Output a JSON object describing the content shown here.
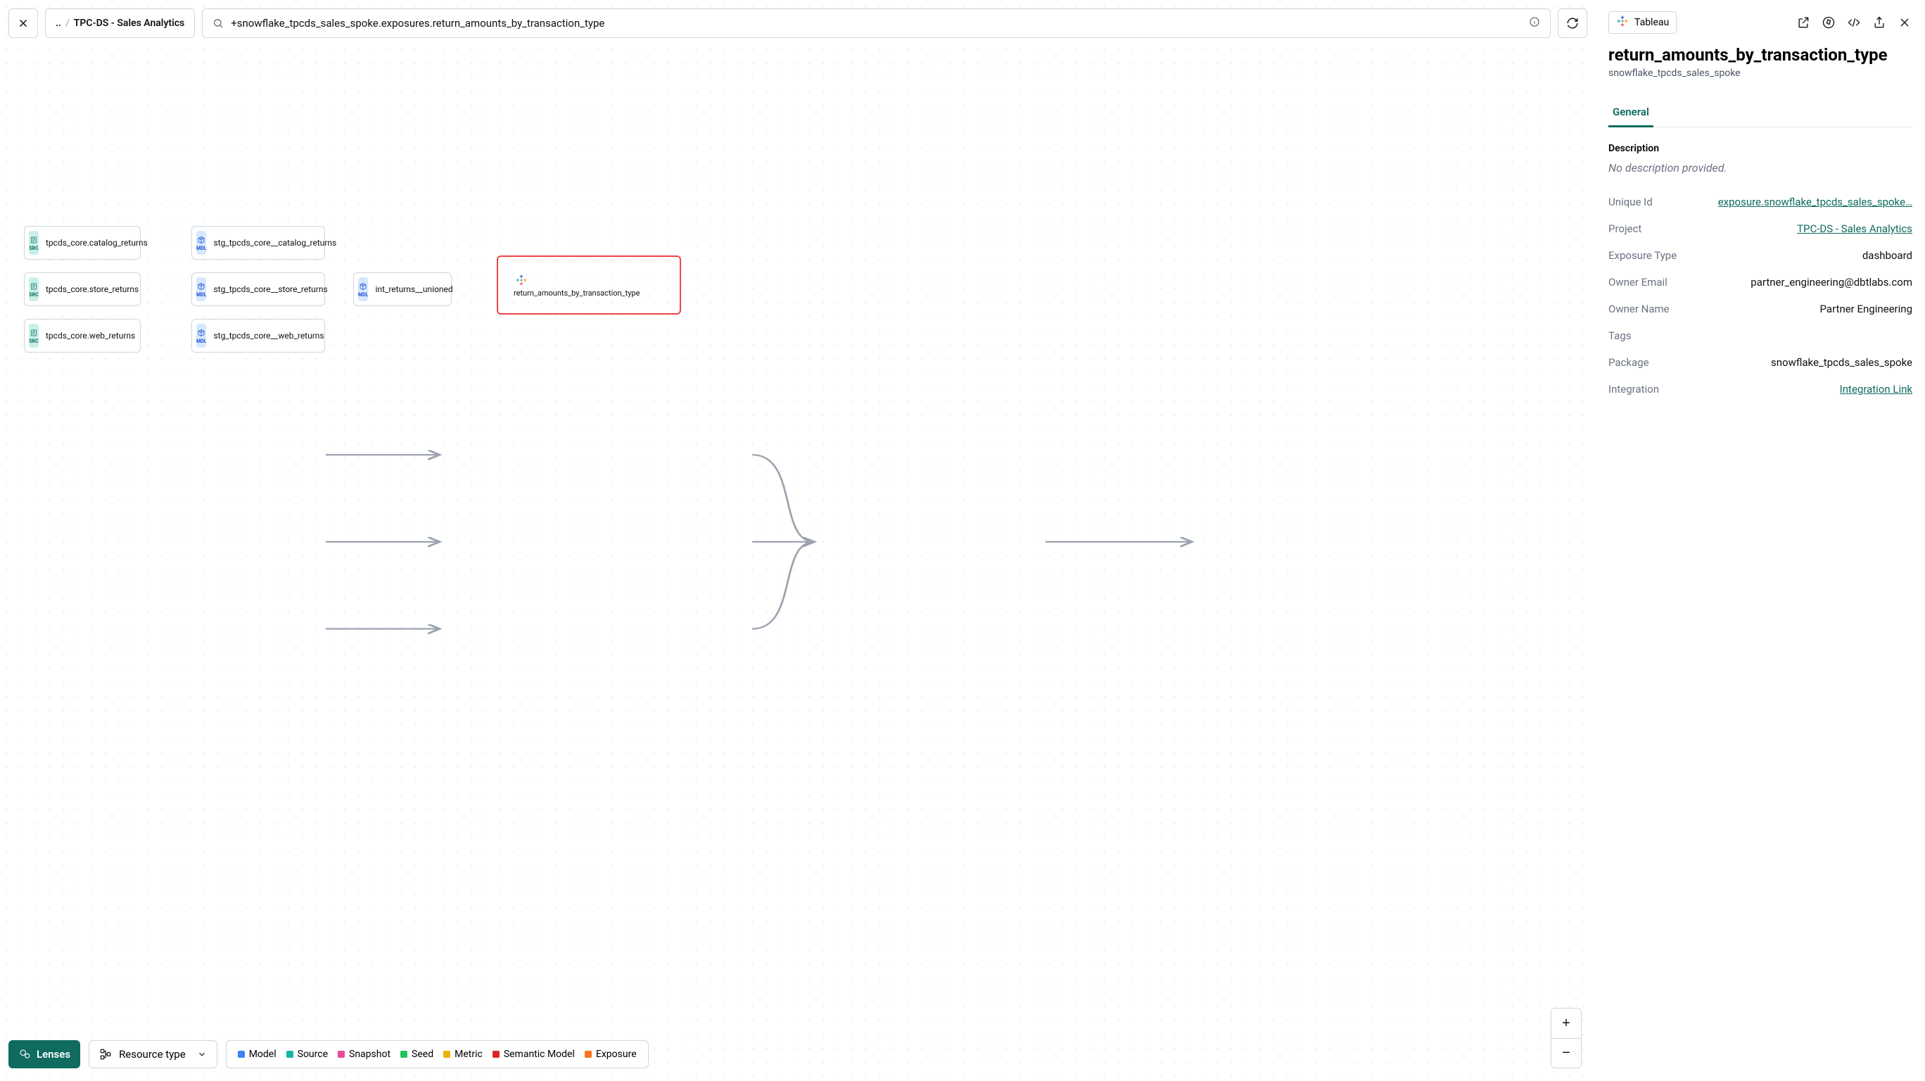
{
  "breadcrumb": {
    "prefix": "..",
    "project": "TPC-DS - Sales Analytics"
  },
  "search": {
    "query": "+snowflake_tpcds_sales_spoke.exposures.return_amounts_by_transaction_type"
  },
  "lenses_label": "Lenses",
  "resource_type_label": "Resource type",
  "legend": [
    {
      "label": "Model",
      "color": "#3b82f6"
    },
    {
      "label": "Source",
      "color": "#14b8a6"
    },
    {
      "label": "Snapshot",
      "color": "#ec4899"
    },
    {
      "label": "Seed",
      "color": "#22c55e"
    },
    {
      "label": "Metric",
      "color": "#eab308"
    },
    {
      "label": "Semantic Model",
      "color": "#dc2626"
    },
    {
      "label": "Exposure",
      "color": "#f97316"
    }
  ],
  "nodes": {
    "src_catalog": {
      "type": "SRC",
      "label": "tpcds_core.catalog_returns"
    },
    "src_store": {
      "type": "SRC",
      "label": "tpcds_core.store_returns"
    },
    "src_web": {
      "type": "SRC",
      "label": "tpcds_core.web_returns"
    },
    "mdl_catalog": {
      "type": "MDL",
      "label": "stg_tpcds_core__catalog_returns"
    },
    "mdl_store": {
      "type": "MDL",
      "label": "stg_tpcds_core__store_returns"
    },
    "mdl_web": {
      "type": "MDL",
      "label": "stg_tpcds_core__web_returns"
    },
    "mdl_union": {
      "type": "MDL",
      "label": "int_returns__unioned"
    },
    "exposure": {
      "type": "EXPOSURE",
      "label": "return_amounts_by_transaction_type"
    }
  },
  "details": {
    "integration_name": "Tableau",
    "title": "return_amounts_by_transaction_type",
    "subtitle": "snowflake_tpcds_sales_spoke",
    "tab_general": "General",
    "section_description": "Description",
    "description_empty": "No description provided.",
    "fields": {
      "unique_id": {
        "k": "Unique Id",
        "v": "exposure.snowflake_tpcds_sales_spoke…",
        "link": true
      },
      "project": {
        "k": "Project",
        "v": "TPC-DS - Sales Analytics",
        "link": true
      },
      "exposure": {
        "k": "Exposure Type",
        "v": "dashboard"
      },
      "owner_email": {
        "k": "Owner Email",
        "v": "partner_engineering@dbtlabs.com"
      },
      "owner_name": {
        "k": "Owner Name",
        "v": "Partner Engineering"
      },
      "tags": {
        "k": "Tags",
        "v": ""
      },
      "package": {
        "k": "Package",
        "v": "snowflake_tpcds_sales_spoke"
      },
      "integration": {
        "k": "Integration",
        "v": "Integration Link",
        "link": true
      }
    }
  }
}
